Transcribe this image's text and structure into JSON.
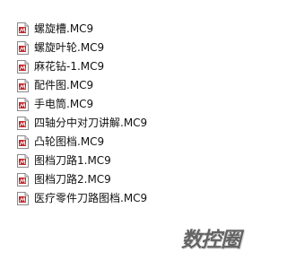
{
  "files": [
    {
      "name": "螺旋槽.MC9",
      "icon": "mc9-file-icon"
    },
    {
      "name": "螺旋叶轮.MC9",
      "icon": "mc9-file-icon"
    },
    {
      "name": "麻花钻-1.MC9",
      "icon": "mc9-file-icon"
    },
    {
      "name": "配件图.MC9",
      "icon": "mc9-file-icon"
    },
    {
      "name": "手电筒.MC9",
      "icon": "mc9-file-icon"
    },
    {
      "name": "四轴分中对刀讲解.MC9",
      "icon": "mc9-file-icon"
    },
    {
      "name": "凸轮图档.MC9",
      "icon": "mc9-file-icon"
    },
    {
      "name": "图档刀路1.MC9",
      "icon": "mc9-file-icon"
    },
    {
      "name": "图档刀路2.MC9",
      "icon": "mc9-file-icon"
    },
    {
      "name": "医疗零件刀路图档.MC9",
      "icon": "mc9-file-icon"
    }
  ],
  "watermark": "数控圈",
  "colors": {
    "text": "#111111",
    "icon_red": "#c0282d",
    "icon_border": "#8a8a8a"
  }
}
